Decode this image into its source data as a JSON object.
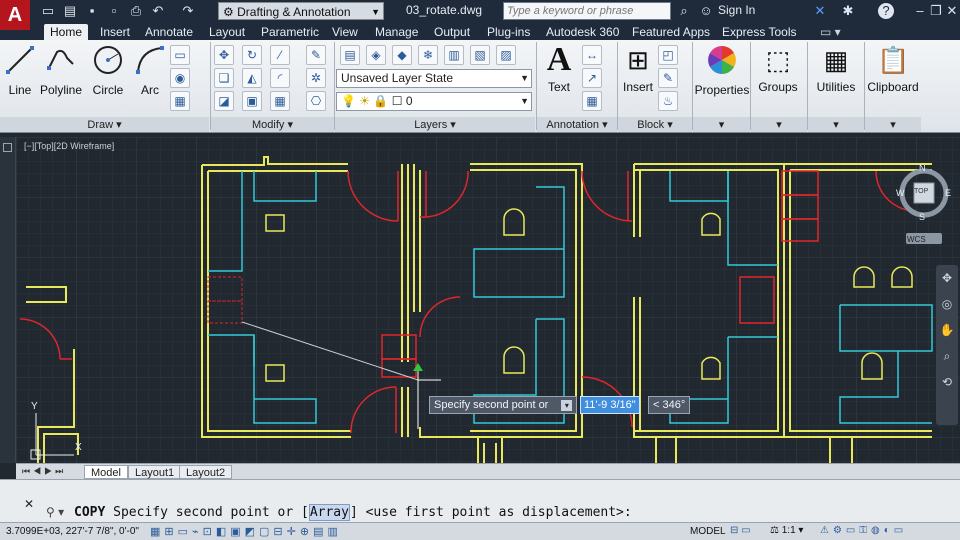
{
  "titlebar": {
    "app_logo": "A",
    "workspace": "Drafting & Annotation",
    "document": "03_rotate.dwg",
    "search_placeholder": "Type a keyword or phrase",
    "sign_in": "Sign In"
  },
  "tabs": [
    {
      "label": "Home",
      "active": true
    },
    {
      "label": "Insert"
    },
    {
      "label": "Annotate"
    },
    {
      "label": "Layout"
    },
    {
      "label": "Parametric"
    },
    {
      "label": "View"
    },
    {
      "label": "Manage"
    },
    {
      "label": "Output"
    },
    {
      "label": "Plug-ins"
    },
    {
      "label": "Autodesk 360"
    },
    {
      "label": "Featured Apps"
    },
    {
      "label": "Express Tools"
    }
  ],
  "ribbon": {
    "draw": {
      "title": "Draw",
      "line": "Line",
      "polyline": "Polyline",
      "circle": "Circle",
      "arc": "Arc"
    },
    "modify": {
      "title": "Modify"
    },
    "layers": {
      "title": "Layers",
      "layer_state": "Unsaved Layer State",
      "current_layer": "0"
    },
    "annotation": {
      "title": "Annotation",
      "text": "Text"
    },
    "block": {
      "title": "Block",
      "insert": "Insert"
    },
    "properties": "Properties",
    "groups": "Groups",
    "utilities": "Utilities",
    "clipboard": "Clipboard"
  },
  "viewport": {
    "label": "[−][Top][2D Wireframe]",
    "viewcube": {
      "n": "N",
      "s": "S",
      "e": "E",
      "w": "W",
      "top": "TOP",
      "wcs": "WCS"
    },
    "ucs": {
      "y": "Y",
      "x": "X"
    }
  },
  "dynamic_input": {
    "prompt": "Specify second point or",
    "distance": "11'-9 3/16\"",
    "angle": "< 346°"
  },
  "layout_tabs": [
    {
      "label": "Model",
      "active": true
    },
    {
      "label": "Layout1"
    },
    {
      "label": "Layout2"
    }
  ],
  "command": {
    "name": "COPY",
    "prompt_before": "Specify second point or [",
    "option": "Array",
    "prompt_after": "] <use first point as displacement>:"
  },
  "status": {
    "coords": "3.7099E+03, 227'-7 7/8\", 0'-0\"",
    "model": "MODEL",
    "scale": "1:1"
  },
  "colors": {
    "walls": "#e8e85a",
    "doors": "#e0262b",
    "furniture": "#34c8d8",
    "background": "#212830"
  }
}
